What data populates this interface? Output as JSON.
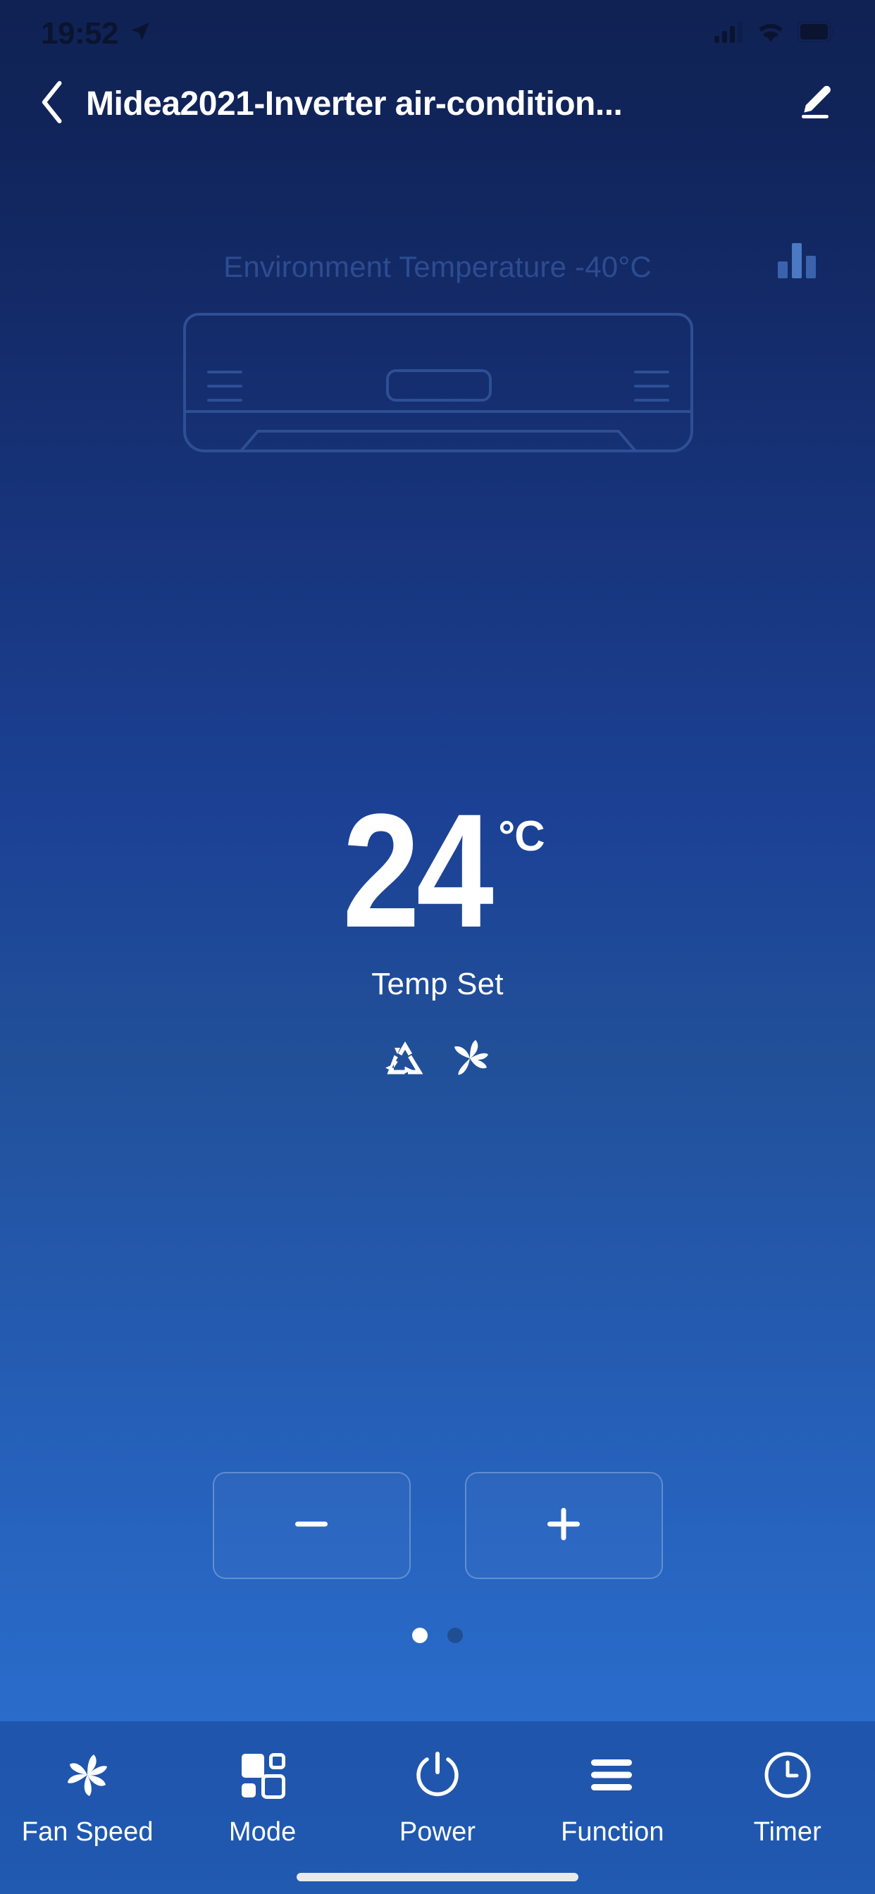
{
  "status_bar": {
    "time": "19:52",
    "location_icon": "location-arrow-icon",
    "signal_icon": "cellular-signal-icon",
    "wifi_icon": "wifi-icon",
    "battery_icon": "battery-icon"
  },
  "header": {
    "back_icon": "back-chevron-icon",
    "title": "Midea2021-Inverter air-condition...",
    "edit_icon": "pencil-edit-icon"
  },
  "environment": {
    "text": "Environment Temperature -40°C",
    "chart_icon": "bar-chart-icon"
  },
  "device": {
    "illustration": "air-conditioner-illustration"
  },
  "temperature": {
    "value": "24",
    "unit": "°C",
    "label": "Temp Set",
    "status_icons": [
      {
        "name": "eco-recycle-icon"
      },
      {
        "name": "fan-blades-icon"
      }
    ]
  },
  "controls": {
    "decrease_label": "−",
    "decrease_icon": "minus-icon",
    "increase_label": "+",
    "increase_icon": "plus-icon"
  },
  "pager": {
    "total": 2,
    "active_index": 0
  },
  "bottom_nav": {
    "items": [
      {
        "label": "Fan Speed",
        "icon": "fan-speed-icon"
      },
      {
        "label": "Mode",
        "icon": "mode-blocks-icon"
      },
      {
        "label": "Power",
        "icon": "power-icon"
      },
      {
        "label": "Function",
        "icon": "function-lines-icon"
      },
      {
        "label": "Timer",
        "icon": "timer-clock-icon"
      }
    ]
  },
  "colors": {
    "background_top": "#102253",
    "background_bottom": "#2e74d4",
    "accent_white": "#ffffff",
    "muted_blue": "#2d4c91",
    "inactive_dot": "#1f4e92"
  }
}
